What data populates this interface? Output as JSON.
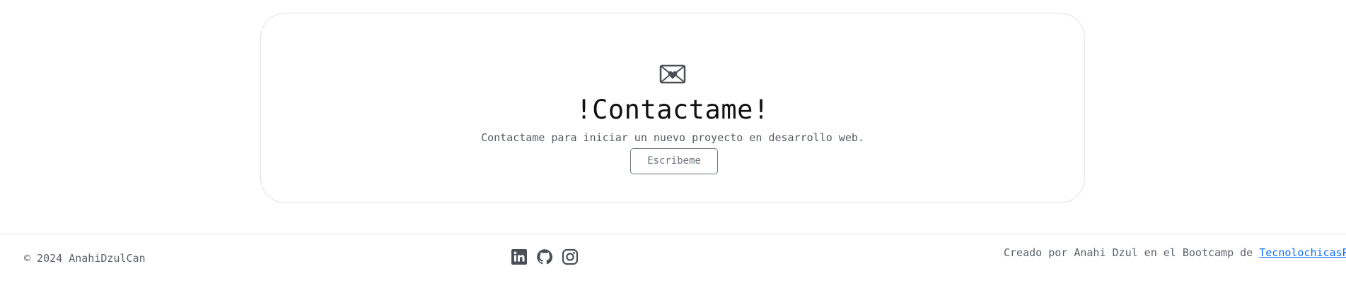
{
  "contact": {
    "icon": "envelope-heart-icon",
    "title": "!Contactame!",
    "subtitle": "Contactame para iniciar un nuevo proyecto en desarrollo web.",
    "button_label": "Escribeme"
  },
  "footer": {
    "copyright": "© 2024 AnahiDzulCan",
    "social": [
      {
        "name": "LinkedIn",
        "icon": "linkedin-icon"
      },
      {
        "name": "GitHub",
        "icon": "github-icon"
      },
      {
        "name": "Instagram",
        "icon": "instagram-icon"
      }
    ],
    "credits_prefix": "Creado por Anahi Dzul en el Bootcamp de ",
    "credits_link": "TecnolochicasPro"
  },
  "colors": {
    "link": "#0d6efd",
    "muted_text": "#5b6168",
    "button_border": "#6c757d",
    "icon": "#4a4f55"
  }
}
